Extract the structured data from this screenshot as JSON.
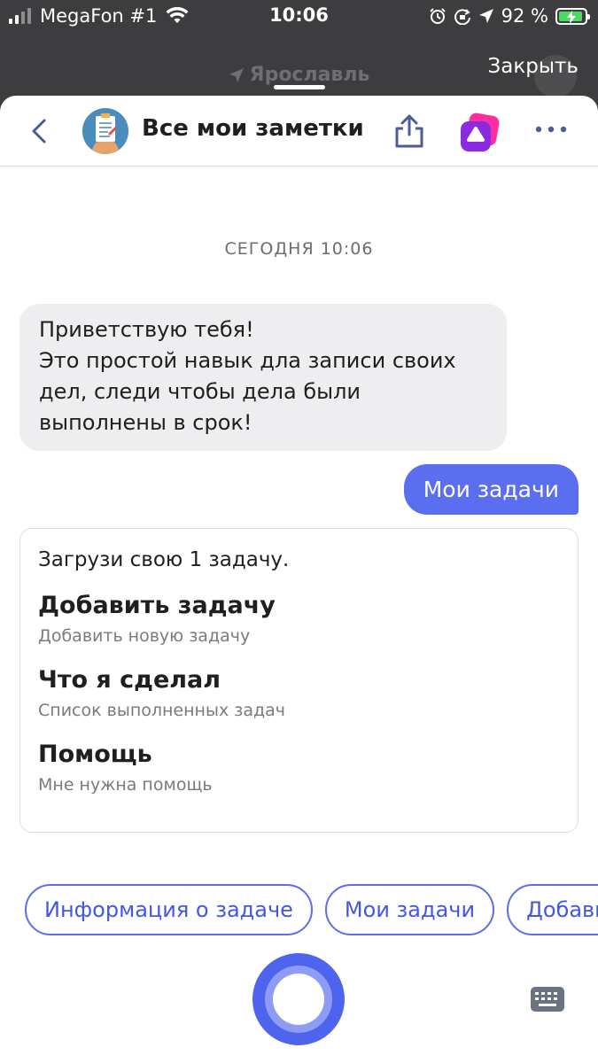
{
  "status_bar": {
    "carrier": "MegaFon #1",
    "time": "10:06",
    "battery": "92 %",
    "battery_level": 0.92
  },
  "backdrop": {
    "location": "Ярославль",
    "close_label": "Закрыть"
  },
  "header": {
    "title": "Все мои заметки"
  },
  "chat": {
    "date_label": "СЕГОДНЯ 10:06",
    "incoming_message": "Приветствую тебя!\nЭто простой навык дла записи своих дел, следи чтобы дела были выполнены в срок!",
    "outgoing_message": "Мои задачи"
  },
  "card": {
    "intro": "Загрузи свою 1 задачу.",
    "items": [
      {
        "title": "Добавить задачу",
        "subtitle": "Добавить новую задачу"
      },
      {
        "title": "Что я сделал",
        "subtitle": "Список выполненных задач"
      },
      {
        "title": "Помощь",
        "subtitle": "Мне нужна помощь"
      }
    ]
  },
  "suggestions": [
    "Информация о задаче",
    "Мои задачи",
    "Добавить задачу"
  ],
  "colors": {
    "accent": "#5b6ef0",
    "bubble_in": "#eeeef0",
    "battery": "#4cd964"
  }
}
